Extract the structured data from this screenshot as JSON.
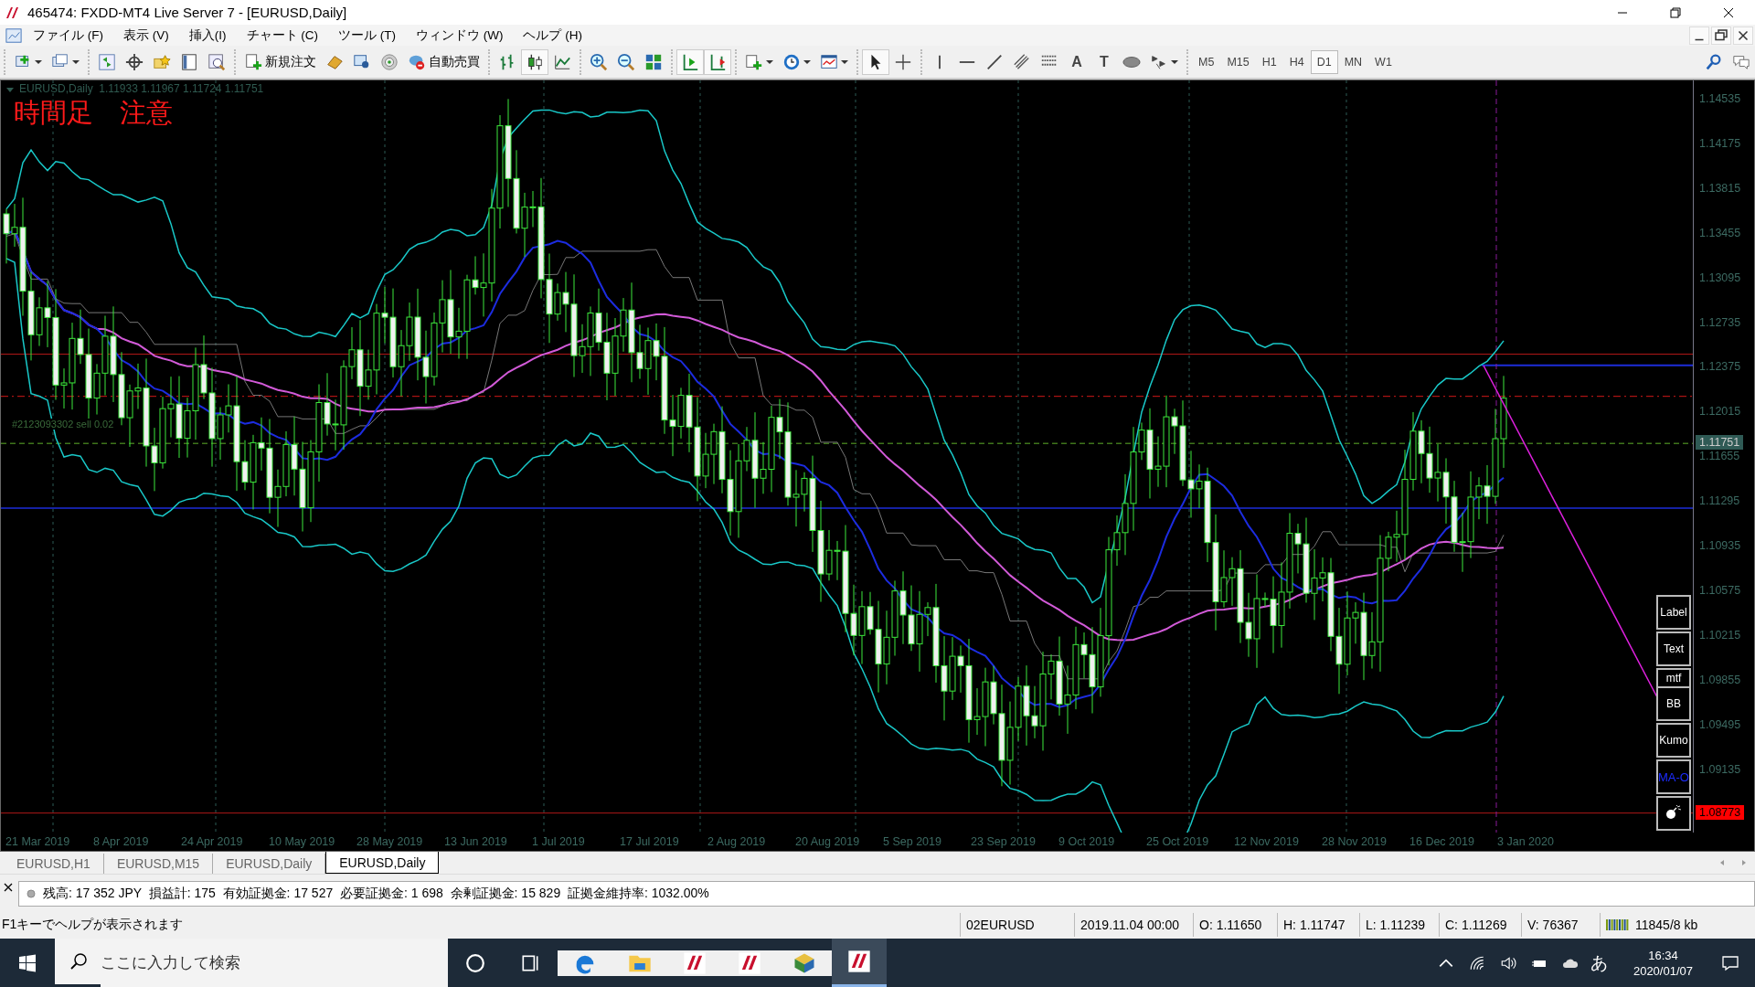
{
  "window": {
    "title": "465474: FXDD-MT4 Live Server 7 - [EURUSD,Daily]"
  },
  "menu": [
    "ファイル (F)",
    "表示 (V)",
    "挿入(I)",
    "チャート (C)",
    "ツール (T)",
    "ウィンドウ (W)",
    "ヘルプ (H)"
  ],
  "toolbar": {
    "new_order": "新規注文",
    "auto_trading": "自動売買",
    "text_tool": "A",
    "label_tool": "T",
    "chart_types": [
      {
        "selected": false
      },
      {
        "selected": true
      },
      {
        "selected": false
      }
    ],
    "timeframes": [
      {
        "label": "M5",
        "selected": false
      },
      {
        "label": "M15",
        "selected": false
      },
      {
        "label": "H1",
        "selected": false
      },
      {
        "label": "H4",
        "selected": false
      },
      {
        "label": "D1",
        "selected": true
      },
      {
        "label": "MN",
        "selected": false
      },
      {
        "label": "W1",
        "selected": false
      }
    ]
  },
  "chart": {
    "symbol_info": "EURUSD,Daily  1.11933 1.11967 1.11724 1.11751",
    "note": "時間足　注意",
    "order_label": "#2123093302 sell 0.02",
    "price_labels": [
      "1.14535",
      "1.14175",
      "1.13815",
      "1.13455",
      "1.13095",
      "1.12735",
      "1.12375",
      "1.12015",
      "1.11655",
      "1.11295",
      "1.10935",
      "1.10575",
      "1.10215",
      "1.09855",
      "1.09495",
      "1.09135"
    ],
    "current_price": "1.11751",
    "line_price": "1.08773",
    "dates": [
      "21 Mar 2019",
      "8 Apr 2019",
      "24 Apr 2019",
      "10 May 2019",
      "28 May 2019",
      "13 Jun 2019",
      "1 Jul 2019",
      "17 Jul 2019",
      "2 Aug 2019",
      "20 Aug 2019",
      "5 Sep 2019",
      "23 Sep 2019",
      "9 Oct 2019",
      "25 Oct 2019",
      "12 Nov 2019",
      "28 Nov 2019",
      "16 Dec 2019",
      "3 Jan 2020"
    ],
    "panel_buttons": [
      {
        "label": "Label",
        "kind": "text"
      },
      {
        "label": "Text",
        "kind": "text"
      },
      {
        "label": "mtf",
        "kind": "small"
      },
      {
        "label": "BB",
        "kind": "text"
      },
      {
        "label": "Kumo",
        "kind": "text"
      },
      {
        "label": "MA-O",
        "kind": "blue"
      },
      {
        "kind": "bomb"
      }
    ]
  },
  "tabs": [
    {
      "label": "EURUSD,H1",
      "selected": false
    },
    {
      "label": "EURUSD,M15",
      "selected": false
    },
    {
      "label": "EURUSD,Daily",
      "selected": false
    },
    {
      "label": "EURUSD,Daily",
      "selected": true
    }
  ],
  "terminal": {
    "account": "残高: 17 352 JPY  損益計: 175  有効証拠金: 17 527  必要証拠金: 1 698  余剰証拠金: 15 829  証拠金維持率: 1032.00%"
  },
  "status_bar": {
    "help": "F1キーでヘルプが表示されます",
    "cells": [
      "02EURUSD",
      "2019.11.04 00:00",
      "O: 1.11650",
      "H: 1.11747",
      "L: 1.11239",
      "C: 1.11269",
      "V: 76367"
    ],
    "traffic": "11845/8 kb"
  },
  "taskbar": {
    "search": {
      "placeholder": "ここに入力して検索"
    },
    "ime": "あ",
    "time": "16:34",
    "date": "2020/01/07"
  }
}
